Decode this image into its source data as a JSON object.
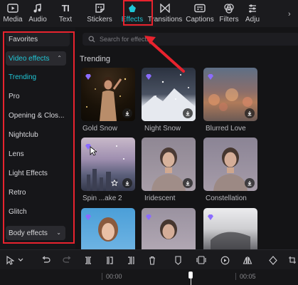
{
  "toolbar": {
    "items": [
      {
        "label": "Media",
        "icon": "media-icon"
      },
      {
        "label": "Audio",
        "icon": "audio-icon"
      },
      {
        "label": "Text",
        "icon": "text-icon"
      },
      {
        "label": "Stickers",
        "icon": "stickers-icon"
      },
      {
        "label": "Effects",
        "icon": "effects-icon"
      },
      {
        "label": "Transitions",
        "icon": "transitions-icon"
      },
      {
        "label": "Captions",
        "icon": "captions-icon"
      },
      {
        "label": "Filters",
        "icon": "filters-icon"
      },
      {
        "label": "Adju",
        "icon": "adjust-icon"
      }
    ],
    "text_icon_glyph": "TI",
    "active": "Effects"
  },
  "sidebar": {
    "favorites": "Favorites",
    "video_effects": "Video effects",
    "items": [
      "Trending",
      "Pro",
      "Opening & Clos...",
      "Nightclub",
      "Lens",
      "Light Effects",
      "Retro",
      "Glitch"
    ],
    "selected": "Trending",
    "body_effects": "Body effects"
  },
  "search": {
    "placeholder": "Search for effects"
  },
  "section": {
    "title": "Trending"
  },
  "effects": [
    {
      "name": "Gold Snow"
    },
    {
      "name": "Night Snow"
    },
    {
      "name": "Blurred Love"
    },
    {
      "name": "Spin ...ake 2"
    },
    {
      "name": "Iridescent"
    },
    {
      "name": "Constellation"
    },
    {
      "name": ""
    },
    {
      "name": ""
    },
    {
      "name": ""
    }
  ],
  "timeline": {
    "start": "00:00",
    "mark": "00:05"
  },
  "colors": {
    "accent": "#20c6d6",
    "highlight": "#e8232e",
    "gem": "#8b6cff"
  }
}
